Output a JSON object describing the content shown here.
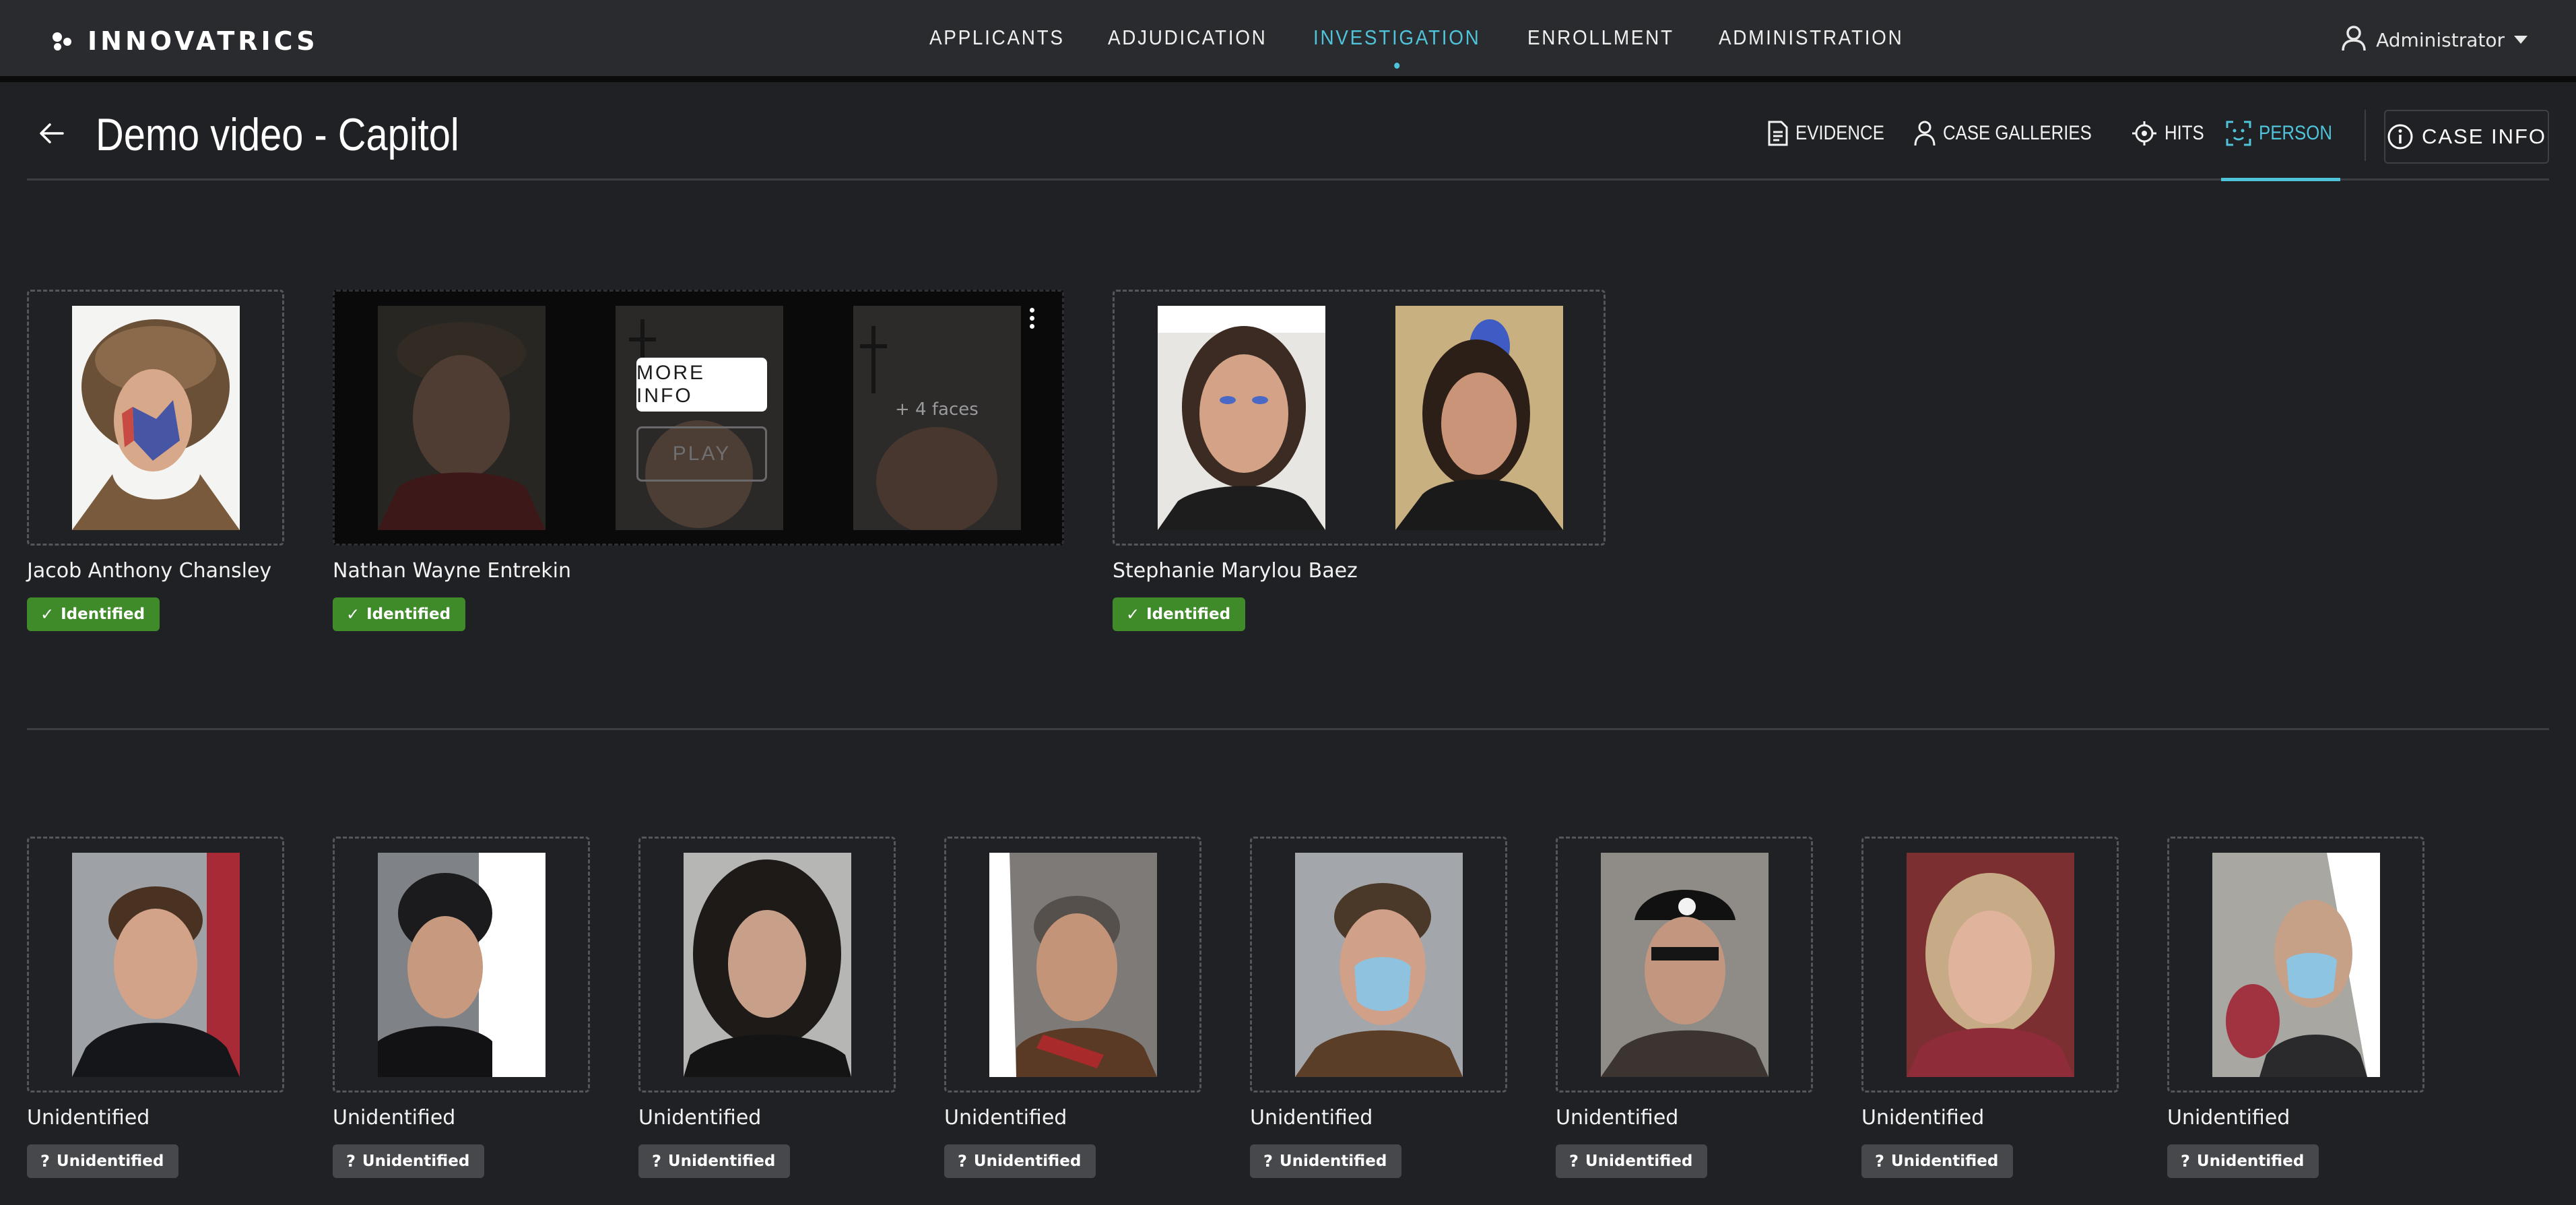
{
  "brand": {
    "name": "INNOVATRICS",
    "icon": "innovatrics-logo-icon"
  },
  "nav": {
    "items": [
      {
        "label": "APPLICANTS"
      },
      {
        "label": "ADJUDICATION"
      },
      {
        "label": "INVESTIGATION",
        "active": true
      },
      {
        "label": "ENROLLMENT"
      },
      {
        "label": "ADMINISTRATION"
      }
    ],
    "active_color": "#4fc3d9"
  },
  "user": {
    "name": "Administrator",
    "icon": "user-icon"
  },
  "page": {
    "title": "Demo video - Capitol"
  },
  "tabs": [
    {
      "label": "EVIDENCE",
      "icon": "document-icon"
    },
    {
      "label": "CASE GALLERIES",
      "icon": "person-icon"
    },
    {
      "label": "HITS",
      "icon": "target-icon"
    },
    {
      "label": "PERSON",
      "icon": "face-scan-icon",
      "active": true
    }
  ],
  "case_info": {
    "label": "CASE INFO",
    "icon": "info-icon"
  },
  "identified": [
    {
      "name": "Jacob Anthony Chansley",
      "status": "Identified",
      "faces": 1
    },
    {
      "name": "Nathan Wayne Entrekin",
      "status": "Identified",
      "faces": 3,
      "more_faces": "+ 4 faces",
      "more_info": "MORE INFO",
      "play": "PLAY"
    },
    {
      "name": "Stephanie Marylou Baez",
      "status": "Identified",
      "faces": 2
    }
  ],
  "unidentified": [
    {
      "name": "Unidentified",
      "status": "Unidentified"
    },
    {
      "name": "Unidentified",
      "status": "Unidentified"
    },
    {
      "name": "Unidentified",
      "status": "Unidentified"
    },
    {
      "name": "Unidentified",
      "status": "Unidentified"
    },
    {
      "name": "Unidentified",
      "status": "Unidentified"
    },
    {
      "name": "Unidentified",
      "status": "Unidentified"
    },
    {
      "name": "Unidentified",
      "status": "Unidentified"
    },
    {
      "name": "Unidentified",
      "status": "Unidentified"
    }
  ],
  "colors": {
    "identified_badge": "#3f8b2a",
    "unidentified_badge": "#47484c",
    "background": "#202124"
  }
}
